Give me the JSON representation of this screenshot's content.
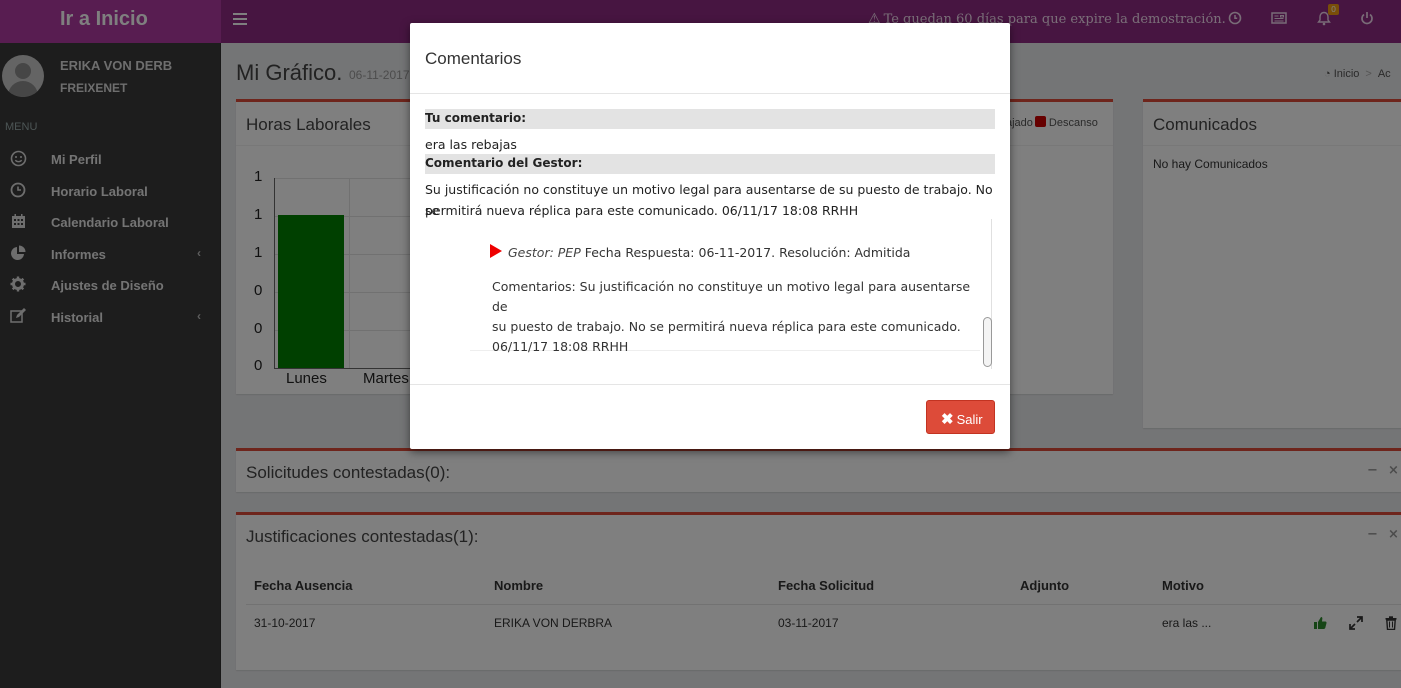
{
  "topbar": {
    "brand": "Ir a Inicio",
    "notice_icon": "⚠",
    "notice": "Te quedan 60 días para que expire la demostración.",
    "notifications_count": "0"
  },
  "sidebar": {
    "user_name": "ERIKA VON DERB",
    "company": "FREIXENET",
    "menu_header": "MENU",
    "items": [
      {
        "label": "Mi Perfil",
        "icon": "smile-icon"
      },
      {
        "label": "Horario Laboral",
        "icon": "clock-icon"
      },
      {
        "label": "Calendario Laboral",
        "icon": "calendar-icon"
      },
      {
        "label": "Informes",
        "icon": "pie-chart-icon",
        "chevron": "‹"
      },
      {
        "label": "Ajustes de Diseño",
        "icon": "gear-icon"
      },
      {
        "label": "Historial",
        "icon": "edit-icon",
        "chevron": "‹"
      }
    ]
  },
  "page": {
    "title": "Mi Gráfico.",
    "date": "06-11-2017",
    "breadcrumb_home": "Inicio",
    "breadcrumb_next": "Ac"
  },
  "horas": {
    "title": "Horas Laborales",
    "legend_trabajado": "ajado",
    "legend_descanso": "Descanso"
  },
  "chart_data": {
    "type": "bar",
    "title": "",
    "categories": [
      "Lunes",
      "Martes"
    ],
    "series": [
      {
        "values": [
          0.8,
          0
        ]
      }
    ],
    "y_tick_labels": [
      "1",
      "1",
      "1",
      "0",
      "0",
      "0"
    ],
    "colors": [
      "#008000"
    ]
  },
  "comunicados": {
    "title": "Comunicados",
    "empty": "No hay Comunicados"
  },
  "solicitudes": {
    "title": "Solicitudes contestadas(0):",
    "minimize": "−",
    "close": "×"
  },
  "justificaciones": {
    "title": "Justificaciones contestadas(1):",
    "minimize": "−",
    "close": "×",
    "columns": [
      "Fecha Ausencia",
      "Nombre",
      "Fecha Solicitud",
      "Adjunto",
      "Motivo"
    ],
    "rows": [
      {
        "fecha_ausencia": "31-10-2017",
        "nombre": "ERIKA VON DERBRA",
        "fecha_solicitud": "03-11-2017",
        "adjunto": "",
        "motivo": "era las ..."
      }
    ]
  },
  "modal": {
    "title": "Comentarios",
    "tu_comentario_label": "Tu comentario:",
    "tu_comentario": "era las rebajas",
    "gestor_label": "Comentario del Gestor:",
    "gestor_text_1": "Su justificación no constituye un motivo legal para ausentarse de su puesto de trabajo. No se",
    "gestor_text_2": "permitirá nueva réplica para este comunicado. 06/11/17 18:08 RRHH",
    "resp_gestor": "Gestor: PEP",
    "resp_fecha": "Fecha Respuesta: 06-11-2017. Resolución: Admitida",
    "resp_comentarios_1": "Comentarios: Su justificación no constituye un motivo legal para ausentarse de",
    "resp_comentarios_2": "su puesto de trabajo. No se permitirá nueva réplica para este comunicado.",
    "resp_comentarios_3": "06/11/17 18:08 RRHH",
    "close_button_icon": "✖",
    "close_button": "Salir"
  },
  "colors": {
    "topbar": "#8e2a83",
    "brand": "#b03aa2",
    "sidebar": "#3b3b3b",
    "accent_danger": "#dd4b39",
    "bar": "#008000"
  }
}
